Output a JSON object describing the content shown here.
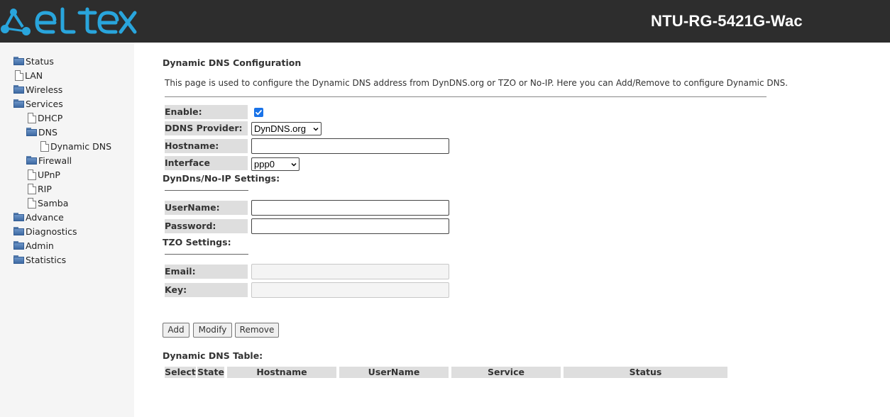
{
  "header": {
    "logo_text": "ELTEX",
    "model": "NTU-RG-5421G-Wac",
    "colors": {
      "background": "#2d2d2d",
      "logo": "#29a5dc"
    }
  },
  "sidebar": {
    "items": [
      {
        "label": "Status",
        "icon": "folder-icon"
      },
      {
        "label": "LAN",
        "icon": "document-icon"
      },
      {
        "label": "Wireless",
        "icon": "folder-icon"
      },
      {
        "label": "Services",
        "icon": "folder-icon"
      },
      {
        "label": "DHCP",
        "icon": "document-icon"
      },
      {
        "label": "DNS",
        "icon": "folder-icon"
      },
      {
        "label": "Dynamic DNS",
        "icon": "document-icon"
      },
      {
        "label": "Firewall",
        "icon": "folder-icon"
      },
      {
        "label": "UPnP",
        "icon": "document-icon"
      },
      {
        "label": "RIP",
        "icon": "document-icon"
      },
      {
        "label": "Samba",
        "icon": "document-icon"
      },
      {
        "label": "Advance",
        "icon": "folder-icon"
      },
      {
        "label": "Diagnostics",
        "icon": "folder-icon"
      },
      {
        "label": "Admin",
        "icon": "folder-icon"
      },
      {
        "label": "Statistics",
        "icon": "folder-icon"
      }
    ]
  },
  "main": {
    "title": "Dynamic DNS Configuration",
    "description": "This page is used to configure the Dynamic DNS address from DynDNS.org or TZO or No-IP. Here you can Add/Remove to configure Dynamic DNS.",
    "form": {
      "enable_label": "Enable:",
      "enable_checked": true,
      "provider_label": "DDNS Provider:",
      "provider_value": "DynDNS.org",
      "hostname_label": "Hostname:",
      "hostname_value": "",
      "interface_label": "Interface",
      "interface_value": "ppp0"
    },
    "dyndns_section": {
      "title": "DynDns/No-IP Settings:",
      "username_label": "UserName:",
      "username_value": "",
      "password_label": "Password:",
      "password_value": ""
    },
    "tzo_section": {
      "title": "TZO Settings:",
      "email_label": "Email:",
      "email_value": "",
      "key_label": "Key:",
      "key_value": ""
    },
    "buttons": {
      "add": "Add",
      "modify": "Modify",
      "remove": "Remove"
    },
    "table": {
      "title": "Dynamic DNS Table:",
      "columns": [
        "Select",
        "State",
        "Hostname",
        "UserName",
        "Service",
        "Status"
      ],
      "rows": []
    }
  }
}
